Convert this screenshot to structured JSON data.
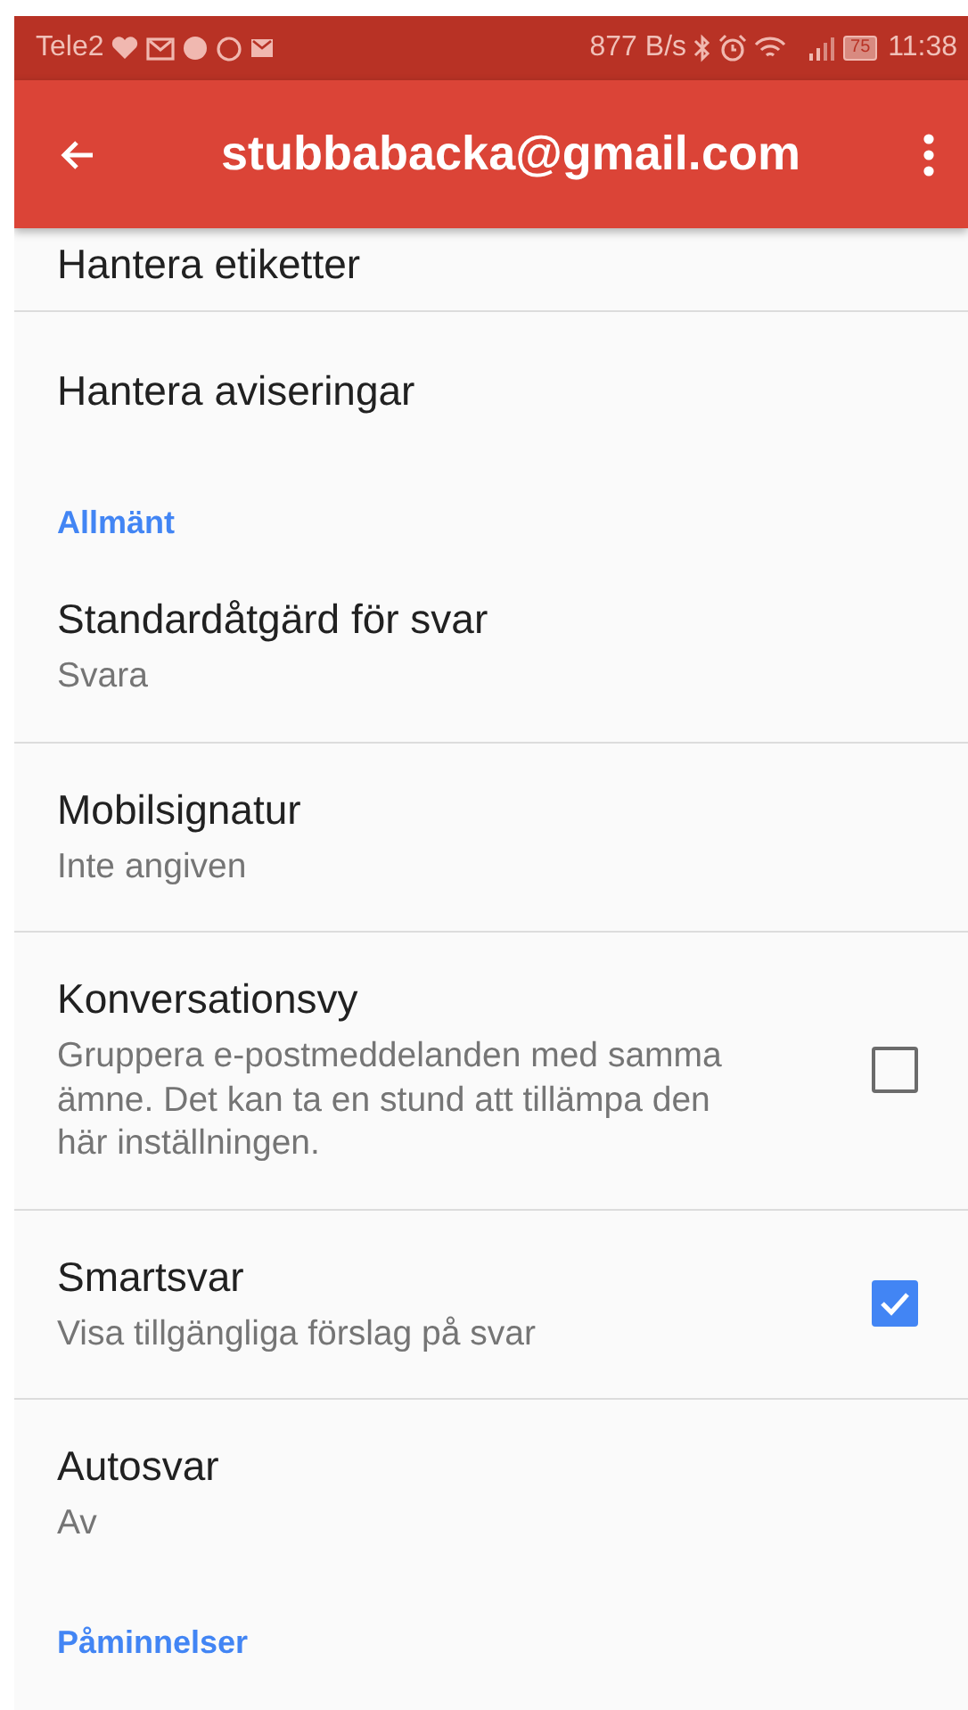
{
  "status_bar": {
    "carrier": "Tele2",
    "speed": "877 B/s",
    "battery": "75",
    "time": "11:38"
  },
  "app_bar": {
    "title": "stubbabacka@gmail.com"
  },
  "items": [
    {
      "kind": "setting",
      "title": "Hantera etiketter",
      "divider": true
    },
    {
      "kind": "setting",
      "title": "Hantera aviseringar",
      "divider": false
    },
    {
      "kind": "section",
      "title": "Allmänt"
    },
    {
      "kind": "setting",
      "title": "Standardåtgärd för svar",
      "summary": "Svara",
      "divider": true
    },
    {
      "kind": "setting",
      "title": "Mobilsignatur",
      "summary": "Inte angiven",
      "divider": true
    },
    {
      "kind": "setting",
      "title": "Konversationsvy",
      "summary": "Gruppera e-postmeddelanden med samma ämne. Det kan ta en stund att tillämpa den här inställningen.",
      "checked": false,
      "divider": true
    },
    {
      "kind": "setting",
      "title": "Smartsvar",
      "summary": "Visa tillgängliga förslag på svar",
      "checked": true,
      "divider": true
    },
    {
      "kind": "setting",
      "title": "Autosvar",
      "summary": "Av",
      "divider": false
    },
    {
      "kind": "section",
      "title": "Påminnelser"
    }
  ]
}
